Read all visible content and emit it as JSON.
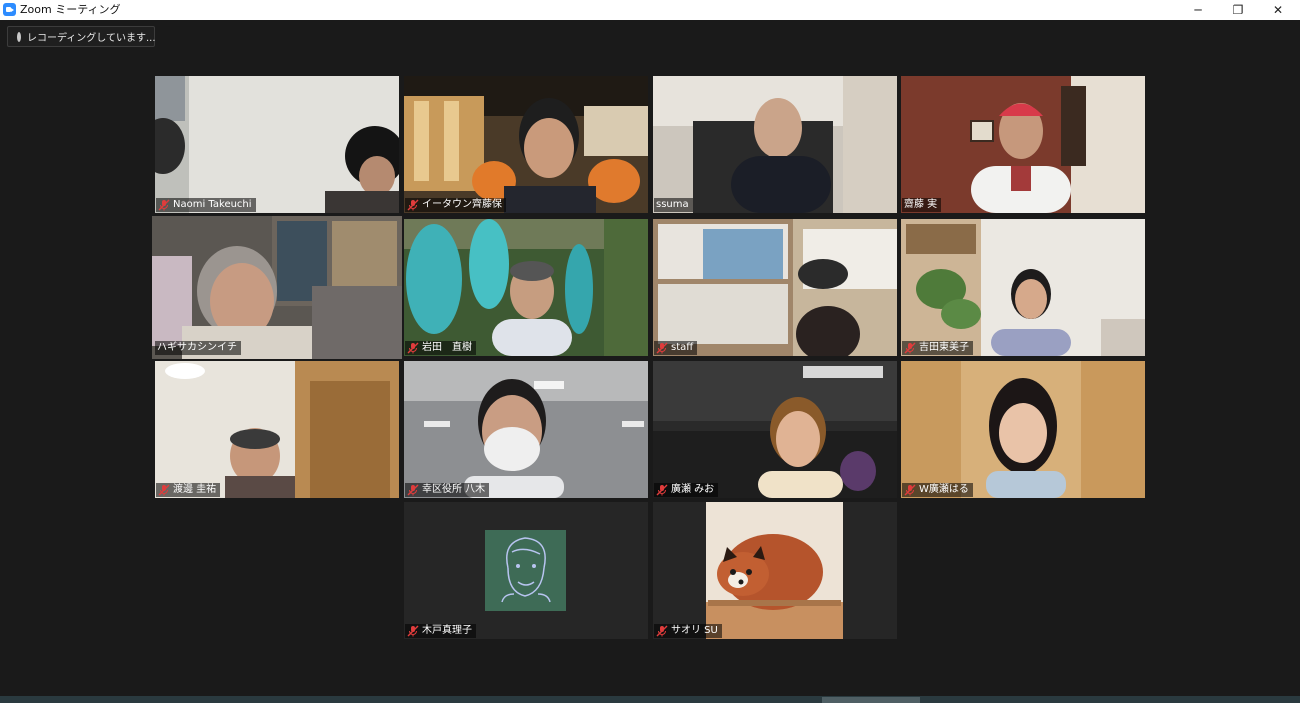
{
  "window": {
    "title": "Zoom ミーティング",
    "controls": {
      "minimize": "─",
      "restore": "❐",
      "close": "✕"
    }
  },
  "recording": {
    "label": "レコーディングしています..."
  },
  "participants": [
    {
      "name": "Naomi Takeuchi",
      "muted": true,
      "active": false
    },
    {
      "name": "イータウン齊藤保",
      "muted": true,
      "active": false
    },
    {
      "name": "ssuma",
      "muted": false,
      "active": false
    },
    {
      "name": "齋藤 実",
      "muted": false,
      "active": false
    },
    {
      "name": "ハギサカシンイチ",
      "muted": false,
      "active": true
    },
    {
      "name": "岩田　直樹",
      "muted": true,
      "active": false
    },
    {
      "name": "staff",
      "muted": true,
      "active": false
    },
    {
      "name": "吉田東美子",
      "muted": true,
      "active": false
    },
    {
      "name": "渡邊 圭祐",
      "muted": true,
      "active": false
    },
    {
      "name": "幸区役所 八木",
      "muted": true,
      "active": false
    },
    {
      "name": "廣瀬 みお",
      "muted": true,
      "active": false
    },
    {
      "name": "W廣瀬はる",
      "muted": true,
      "active": false
    },
    {
      "name": "木戸真理子",
      "muted": true,
      "active": false
    },
    {
      "name": "サオリ SU",
      "muted": true,
      "active": false
    }
  ],
  "icons": {
    "muted": "mic-muted-icon",
    "recording": "recording-dot-icon"
  },
  "colors": {
    "active_speaker": "#e9f06b",
    "muted_mic": "#e03c3c",
    "background": "#1a1a1a"
  }
}
